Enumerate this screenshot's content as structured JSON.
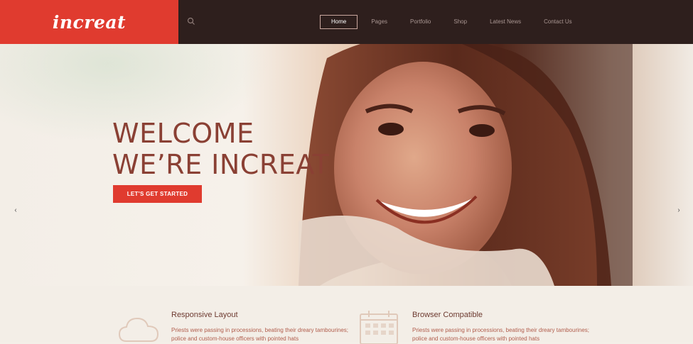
{
  "brand": {
    "logo": "increat",
    "accent": "#e03b2f",
    "dark": "#2e1f1d"
  },
  "header": {
    "search_icon": "search-icon"
  },
  "nav": {
    "items": [
      {
        "label": "Home",
        "active": true
      },
      {
        "label": "Pages",
        "active": false
      },
      {
        "label": "Portfolio",
        "active": false
      },
      {
        "label": "Shop",
        "active": false
      },
      {
        "label": "Latest News",
        "active": false
      },
      {
        "label": "Contact Us",
        "active": false
      }
    ]
  },
  "hero": {
    "line1": "WELCOME",
    "line2": "WE’RE INCREAT",
    "cta": "LET'S GET STARTED",
    "prev_icon": "chevron-left-icon",
    "next_icon": "chevron-right-icon",
    "slides": 3,
    "active_slide": 3
  },
  "features": [
    {
      "icon": "cloud-icon",
      "title": "Responsive Layout",
      "text": "Priests were passing in processions, beating their dreary tambourines; police and custom-house officers with pointed hats"
    },
    {
      "icon": "calendar-icon",
      "title": "Browser Compatible",
      "text": "Priests were passing in processions, beating their dreary tambourines; police and custom-house officers with pointed hats"
    }
  ]
}
